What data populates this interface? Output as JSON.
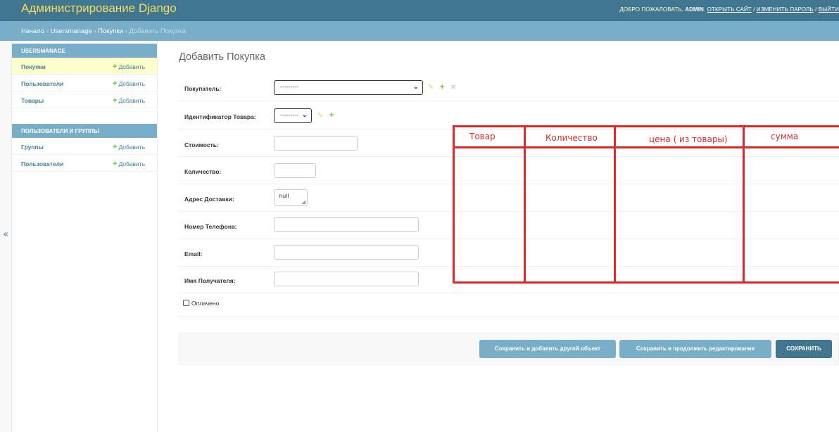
{
  "header": {
    "brand": "Администрирование Django",
    "welcome": "ДОБРО ПОЖАЛОВАТЬ, ",
    "username": "ADMIN",
    "sep1": ". ",
    "view_site": "ОТКРЫТЬ САЙТ",
    "sep2": " / ",
    "change_password": "ИЗМЕНИТЬ ПАРОЛЬ",
    "sep3": " / ",
    "logout": "ВЫЙТИ"
  },
  "breadcrumbs": {
    "home": "Начало",
    "sep": " › ",
    "app": "Usersmanage",
    "model": "Покупки",
    "current": "Добавить Покупка"
  },
  "sidebar": {
    "toggle": "«",
    "modules": [
      {
        "caption": "USERSMANAGE",
        "rows": [
          {
            "label": "Покупки",
            "add": "Добавить"
          },
          {
            "label": "Пользователи",
            "add": "Добавить"
          },
          {
            "label": "Товары",
            "add": "Добавить"
          }
        ]
      },
      {
        "caption": "ПОЛЬЗОВАТЕЛИ И ГРУППЫ",
        "rows": [
          {
            "label": "Группы",
            "add": "Добавить"
          },
          {
            "label": "Пользователи",
            "add": "Добавить"
          }
        ]
      }
    ]
  },
  "form": {
    "title": "Добавить Покупка",
    "fields": {
      "buyer": {
        "label": "Покупатель:",
        "value": "---------"
      },
      "product": {
        "label": "Идентификатор Товара:",
        "value": "---------"
      },
      "cost": {
        "label": "Стоимость:",
        "value": ""
      },
      "quantity": {
        "label": "Количество:",
        "value": ""
      },
      "address": {
        "label": "Адрес Доставки:",
        "value": "null"
      },
      "phone": {
        "label": "Номер Телефона:",
        "value": ""
      },
      "email": {
        "label": "Email:",
        "value": ""
      },
      "recipient": {
        "label": "Имя Получателя:",
        "value": ""
      }
    },
    "paid_label": "Оплачено",
    "paid_checked": false
  },
  "buttons": {
    "save_add_another": "Сохранить и добавить другой объект",
    "save_continue": "Сохранить и продолжить редактирование",
    "save": "СОХРАНИТЬ"
  },
  "annotation": {
    "col1": "Товар",
    "col2": "Количество",
    "col3": "цена ( из товары)",
    "col4": "сумма",
    "color": "#e12828"
  },
  "colors": {
    "header_bg": "#417690",
    "brand": "#f5dd5d",
    "breadcrumbs_bg": "#79aec8",
    "module_caption_bg": "#79aec8",
    "current_row_bg": "#ffffcc",
    "link": "#447e9b",
    "add_plus": "#70bf2b"
  }
}
